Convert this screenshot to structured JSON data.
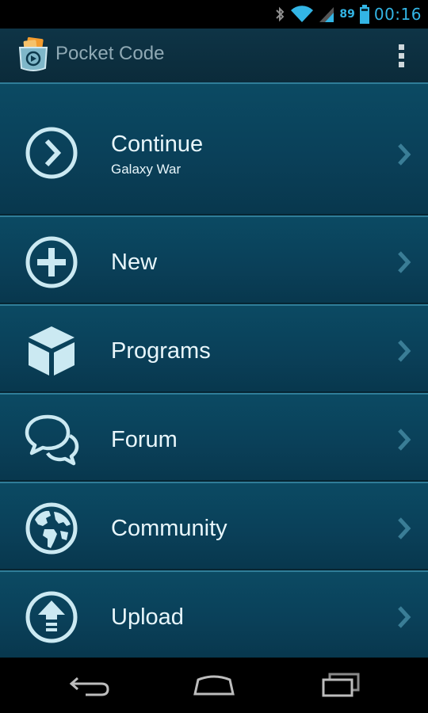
{
  "status_bar": {
    "battery": "89",
    "time": "00:16",
    "icons": [
      "bluetooth-icon",
      "wifi-icon",
      "signal-icon",
      "battery-icon"
    ]
  },
  "action_bar": {
    "title": "Pocket Code",
    "app_icon": "pocket-code-logo-icon",
    "overflow_icon": "overflow-menu-icon"
  },
  "menu": {
    "items": [
      {
        "label": "Continue",
        "sublabel": "Galaxy War",
        "icon": "arrow-circle-icon"
      },
      {
        "label": "New",
        "icon": "plus-circle-icon"
      },
      {
        "label": "Programs",
        "icon": "cube-icon"
      },
      {
        "label": "Forum",
        "icon": "chat-bubbles-icon"
      },
      {
        "label": "Community",
        "icon": "globe-icon"
      },
      {
        "label": "Upload",
        "icon": "upload-icon"
      }
    ]
  },
  "nav_bar": {
    "buttons": [
      "back-icon",
      "home-icon",
      "recent-apps-icon"
    ]
  },
  "colors": {
    "accent": "#33b5e5",
    "item_background": "#0a4059",
    "icon_color": "#cbe9f2"
  }
}
